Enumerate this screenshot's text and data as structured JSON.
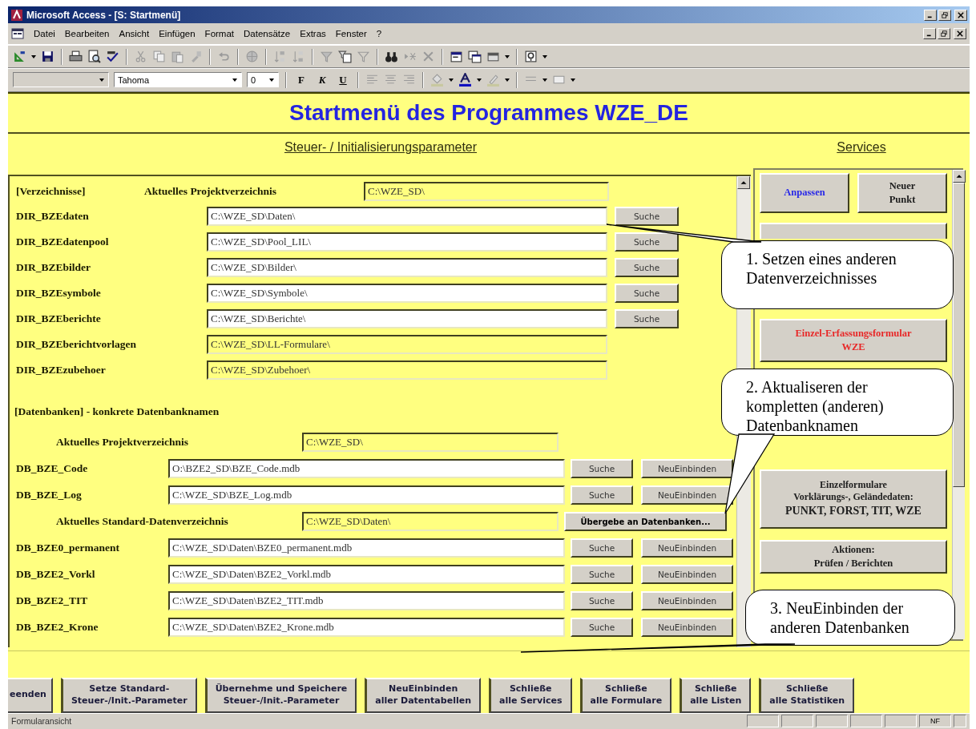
{
  "window": {
    "title": "Microsoft Access - [S: Startmenü]"
  },
  "menu": [
    "Datei",
    "Bearbeiten",
    "Ansicht",
    "Einfügen",
    "Format",
    "Datensätze",
    "Extras",
    "Fenster",
    "?"
  ],
  "format_toolbar": {
    "font": "Tahoma",
    "size": "0",
    "style_buttons": [
      "F",
      "K",
      "U"
    ]
  },
  "form": {
    "title": "Startmenü des Programmes WZE_DE",
    "params_heading": "Steuer- / Initialisierungsparameter",
    "services_heading": "Services",
    "directories": {
      "heading": "[Verzeichnisse]",
      "project_label": "Aktuelles Projektverzeichnis",
      "project_value": "C:\\WZE_SD\\",
      "rows": [
        {
          "label": "DIR_BZEdaten",
          "value": "C:\\WZE_SD\\Daten\\",
          "kind": "editable",
          "buttons": [
            "Suche"
          ]
        },
        {
          "label": "DIR_BZEdatenpool",
          "value": "C:\\WZE_SD\\Pool_LIL\\",
          "kind": "editable",
          "buttons": [
            "Suche"
          ]
        },
        {
          "label": "DIR_BZEbilder",
          "value": "C:\\WZE_SD\\Bilder\\",
          "kind": "editable",
          "buttons": [
            "Suche"
          ]
        },
        {
          "label": "DIR_BZEsymbole",
          "value": "C:\\WZE_SD\\Symbole\\",
          "kind": "editable",
          "buttons": [
            "Suche"
          ]
        },
        {
          "label": "DIR_BZEberichte",
          "value": "C:\\WZE_SD\\Berichte\\",
          "kind": "editable",
          "buttons": [
            "Suche"
          ]
        },
        {
          "label": "DIR_BZEberichtvorlagen",
          "value": "C:\\WZE_SD\\LL-Formulare\\",
          "kind": "readonly"
        },
        {
          "label": "DIR_BZEzubehoer",
          "value": "C:\\WZE_SD\\Zubehoer\\",
          "kind": "readonly"
        }
      ]
    },
    "databases": {
      "heading": "[Datenbanken] - konkrete Datenbanknamen",
      "rows": [
        {
          "label": "Aktuelles Projektverzeichnis",
          "value": "C:\\WZE_SD\\",
          "kind": "info"
        },
        {
          "label": "DB_BZE_Code",
          "value": "O:\\BZE2_SD\\BZE_Code.mdb",
          "kind": "db",
          "buttons": [
            "Suche",
            "NeuEinbinden"
          ]
        },
        {
          "label": "DB_BZE_Log",
          "value": "C:\\WZE_SD\\BZE_Log.mdb",
          "kind": "db",
          "buttons": [
            "Suche",
            "NeuEinbinden"
          ]
        },
        {
          "label": "Aktuelles Standard-Datenverzeichnis",
          "value": "C:\\WZE_SD\\Daten\\",
          "kind": "info",
          "buttons": [
            "Übergebe an Datenbanken..."
          ]
        },
        {
          "label": "DB_BZE0_permanent",
          "value": "C:\\WZE_SD\\Daten\\BZE0_permanent.mdb",
          "kind": "db",
          "buttons": [
            "Suche",
            "NeuEinbinden"
          ]
        },
        {
          "label": "DB_BZE2_Vorkl",
          "value": "C:\\WZE_SD\\Daten\\BZE2_Vorkl.mdb",
          "kind": "db",
          "buttons": [
            "Suche",
            "NeuEinbinden"
          ]
        },
        {
          "label": "DB_BZE2_TIT",
          "value": "C:\\WZE_SD\\Daten\\BZE2_TIT.mdb",
          "kind": "db",
          "buttons": [
            "Suche",
            "NeuEinbinden"
          ]
        },
        {
          "label": "DB_BZE2_Krone",
          "value": "C:\\WZE_SD\\Daten\\BZE2_Krone.mdb",
          "kind": "db",
          "buttons": [
            "Suche",
            "NeuEinbinden"
          ]
        }
      ]
    },
    "services": [
      {
        "kind": "half",
        "lines": [
          "Anpassen"
        ],
        "color": "#2828e8"
      },
      {
        "kind": "half",
        "lines": [
          "Neuer",
          "Punkt"
        ],
        "color": "#202020"
      },
      {
        "kind": "covered"
      },
      {
        "kind": "full",
        "lines": [
          "Einzel-Erfassungsformular",
          "WZE"
        ],
        "color": "#e82828"
      },
      {
        "kind": "full",
        "lines": [
          "Einzelformulare",
          "Vorklärungs-, Geländedaten:",
          "PUNKT, FORST, TIT, WZE"
        ],
        "color": "#202020"
      },
      {
        "kind": "full",
        "lines": [
          "Aktionen:",
          "Prüfen / Berichten"
        ],
        "color": "#202020"
      }
    ],
    "bottom_buttons": [
      {
        "lines": [
          "eenden"
        ]
      },
      {
        "lines": [
          "Setze Standard-",
          "Steuer-/Init.-Parameter"
        ]
      },
      {
        "lines": [
          "Übernehme und Speichere",
          "Steuer-/Init.-Parameter"
        ]
      },
      {
        "lines": [
          "NeuEinbinden",
          "aller Datentabellen"
        ]
      },
      {
        "lines": [
          "Schließe",
          "alle Services"
        ]
      },
      {
        "lines": [
          "Schließe",
          "alle Formulare"
        ]
      },
      {
        "lines": [
          "Schließe",
          "alle Listen"
        ]
      },
      {
        "lines": [
          "Schließe",
          "alle Statistiken"
        ]
      }
    ]
  },
  "callouts": [
    {
      "lines": [
        "1. Setzen eines anderen",
        "Datenverzeichnisses"
      ]
    },
    {
      "lines": [
        "2. Aktualiseren der",
        "kompletten (anderen)",
        "Datenbanknamen"
      ]
    },
    {
      "lines": [
        "3. NeuEinbinden der",
        "anderen Datenbanken"
      ]
    }
  ],
  "status_bar": {
    "text": "Formularansicht",
    "indicator": "NF"
  }
}
